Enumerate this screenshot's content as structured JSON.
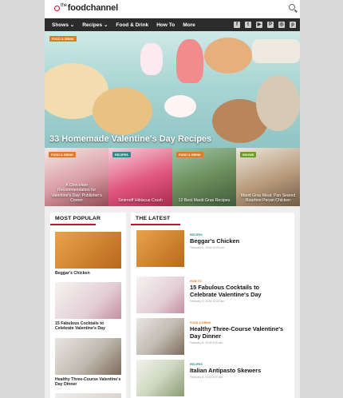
{
  "header": {
    "logo_prefix": "the",
    "logo_text": "foodchannel"
  },
  "nav": {
    "items": [
      "Shows ⌄",
      "Recipes ⌄",
      "Food & Drink",
      "How To",
      "More"
    ],
    "social": [
      "f",
      "t",
      "▶",
      "P",
      "◎",
      "p"
    ]
  },
  "hero": {
    "tag": "FOOD & DRINK",
    "title": "33 Homemade Valentine's Day Recipes"
  },
  "cards": [
    {
      "tag": "FOOD & DRINK",
      "tag_color": "#e87722",
      "title": "A Chocolate Recommendation for Valentine's Day: Publisher's Corner"
    },
    {
      "tag": "RECIPES",
      "tag_color": "#2e8b8b",
      "title": "Smirnoff Hibiscus Crush"
    },
    {
      "tag": "FOOD & DRINK",
      "tag_color": "#e87722",
      "title": "12 Best Mardi Gras Recipes"
    },
    {
      "tag": "SHOWS",
      "tag_color": "#6aa121",
      "title": "Mardi Gras Meal: Pan Seared Bourbon Pecan Chicken"
    }
  ],
  "most_popular": {
    "heading": "MOST POPULAR",
    "items": [
      "Beggar's Chicken",
      "15 Fabulous Cocktails to Celebrate Valentine's Day",
      "Healthy Three-Course Valentine's Day Dinner"
    ]
  },
  "latest": {
    "heading": "THE LATEST",
    "items": [
      {
        "tag": "RECIPES",
        "tag_color": "#2e8b8b",
        "title": "Beggar's Chicken",
        "date": "February 8, 2018 12:00 pm"
      },
      {
        "tag": "HOW TO",
        "tag_color": "#e87722",
        "title": "15 Fabulous Cocktails to Celebrate Valentine's Day",
        "date": "February 8, 2018 10:00 am"
      },
      {
        "tag": "FOOD & DRINK",
        "tag_color": "#e87722",
        "title": "Healthy Three-Course Valentine's Day Dinner",
        "date": "February 8, 2018 9:00 am"
      },
      {
        "tag": "RECIPES",
        "tag_color": "#2e8b8b",
        "title": "Italian Antipasto Skewers",
        "date": "February 8, 2018 8:00 am"
      }
    ]
  }
}
